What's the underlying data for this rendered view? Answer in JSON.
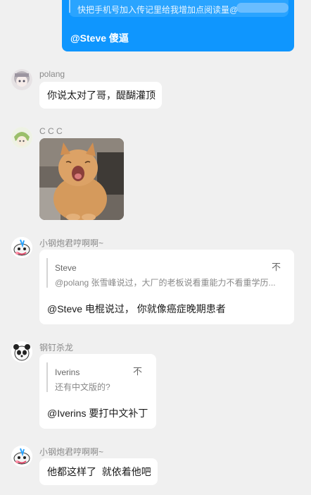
{
  "own_message": {
    "quote_text": "快把手机号加入传记里给我增加点阅读量@",
    "text": "@Steve 傻逼"
  },
  "messages": [
    {
      "sender": "polang",
      "text": "你说太对了哥，醍醐灌顶"
    },
    {
      "sender": "C C C"
    },
    {
      "sender": "小钢炮君哼啊啊~",
      "quote_name": "Steve",
      "quote_text": "@polang 张雪峰说过，大厂的老板说看重能力不看重学历...",
      "quote_icon": "不",
      "text": "@Steve 电棍说过， 你就像癌症晚期患者"
    },
    {
      "sender": "钢钉杀龙",
      "quote_name": "Iverins",
      "quote_text": "还有中文版的?",
      "quote_icon": "不",
      "text": "@Iverins 要打中文补丁"
    },
    {
      "sender": "小钢炮君哼啊啊~",
      "text": "他都这样了  就依着他吧"
    }
  ],
  "icons": {
    "quote_jump": "quote-jump-icon"
  }
}
